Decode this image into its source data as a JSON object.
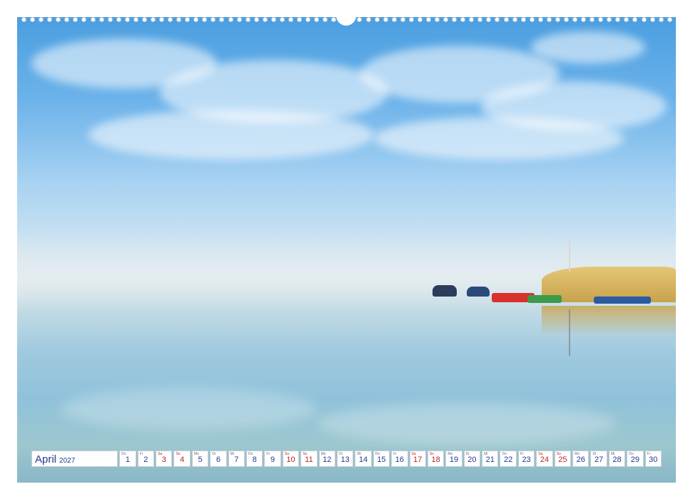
{
  "calendar": {
    "month": "April",
    "year": "2027",
    "days": [
      {
        "wd": "Do",
        "d": "1",
        "red": false
      },
      {
        "wd": "Fr",
        "d": "2",
        "red": false
      },
      {
        "wd": "Sa",
        "d": "3",
        "red": true
      },
      {
        "wd": "So",
        "d": "4",
        "red": true
      },
      {
        "wd": "Mo",
        "d": "5",
        "red": false
      },
      {
        "wd": "Di",
        "d": "6",
        "red": false
      },
      {
        "wd": "Mi",
        "d": "7",
        "red": false
      },
      {
        "wd": "Do",
        "d": "8",
        "red": false
      },
      {
        "wd": "Fr",
        "d": "9",
        "red": false
      },
      {
        "wd": "Sa",
        "d": "10",
        "red": true
      },
      {
        "wd": "So",
        "d": "11",
        "red": true
      },
      {
        "wd": "Mo",
        "d": "12",
        "red": false
      },
      {
        "wd": "Di",
        "d": "13",
        "red": false
      },
      {
        "wd": "Mi",
        "d": "14",
        "red": false
      },
      {
        "wd": "Do",
        "d": "15",
        "red": false
      },
      {
        "wd": "Fr",
        "d": "16",
        "red": false
      },
      {
        "wd": "Sa",
        "d": "17",
        "red": true
      },
      {
        "wd": "So",
        "d": "18",
        "red": true
      },
      {
        "wd": "Mo",
        "d": "19",
        "red": false
      },
      {
        "wd": "Di",
        "d": "20",
        "red": false
      },
      {
        "wd": "Mi",
        "d": "21",
        "red": false
      },
      {
        "wd": "Do",
        "d": "22",
        "red": false
      },
      {
        "wd": "Fr",
        "d": "23",
        "red": false
      },
      {
        "wd": "Sa",
        "d": "24",
        "red": true
      },
      {
        "wd": "So",
        "d": "25",
        "red": true
      },
      {
        "wd": "Mo",
        "d": "26",
        "red": false
      },
      {
        "wd": "Di",
        "d": "27",
        "red": false
      },
      {
        "wd": "Mi",
        "d": "28",
        "red": false
      },
      {
        "wd": "Do",
        "d": "29",
        "red": false
      },
      {
        "wd": "Fr",
        "d": "30",
        "red": false
      }
    ]
  },
  "colors": {
    "text": "#233a8c",
    "weekend": "#c0242c",
    "sky": "#4a9ee0",
    "reeds": "#e3c777"
  }
}
